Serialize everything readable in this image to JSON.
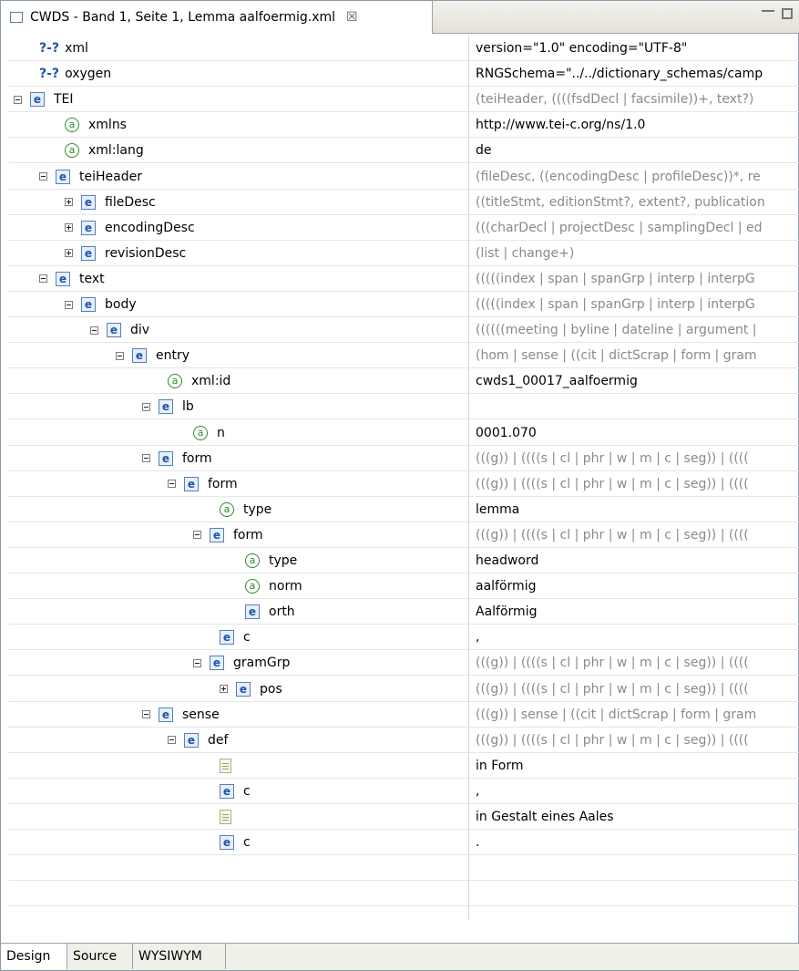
{
  "window": {
    "tab_title": "CWDS - Band 1, Seite 1, Lemma aalfoermig.xml",
    "close_glyph": "☒"
  },
  "bottom_tabs": [
    "Design",
    "Source",
    "WYSIWYM"
  ],
  "rows": [
    {
      "kind": "pi",
      "label": "xml",
      "value": "version=\"1.0\" encoding=\"UTF-8\"",
      "gray": false
    },
    {
      "kind": "pi",
      "label": "oxygen",
      "value": "RNGSchema=\"../../dictionary_schemas/camp",
      "gray": false
    },
    {
      "kind": "element",
      "label": "TEI",
      "value": "(teiHeader, ((((fsdDecl | facsimile))+, text?)",
      "gray": true,
      "toggle": "minus"
    },
    {
      "kind": "attr",
      "label": "xmlns",
      "value": "http://www.tei-c.org/ns/1.0",
      "gray": false
    },
    {
      "kind": "attr",
      "label": "xml:lang",
      "value": "de",
      "gray": false
    },
    {
      "kind": "element",
      "label": "teiHeader",
      "value": "(fileDesc, ((encodingDesc | profileDesc))*, re",
      "gray": true,
      "toggle": "minus"
    },
    {
      "kind": "element",
      "label": "fileDesc",
      "value": "((titleStmt, editionStmt?, extent?, publication",
      "gray": true,
      "toggle": "plus"
    },
    {
      "kind": "element",
      "label": "encodingDesc",
      "value": "(((charDecl | projectDesc | samplingDecl | ed",
      "gray": true,
      "toggle": "plus"
    },
    {
      "kind": "element",
      "label": "revisionDesc",
      "value": "(list | change+)",
      "gray": true,
      "toggle": "plus"
    },
    {
      "kind": "element",
      "label": "text",
      "value": "(((((index | span | spanGrp | interp | interpG",
      "gray": true,
      "toggle": "minus"
    },
    {
      "kind": "element",
      "label": "body",
      "value": "(((((index | span | spanGrp | interp | interpG",
      "gray": true,
      "toggle": "minus"
    },
    {
      "kind": "element",
      "label": "div",
      "value": "((((((meeting | byline | dateline | argument |",
      "gray": true,
      "toggle": "minus"
    },
    {
      "kind": "element",
      "label": "entry",
      "value": "(hom | sense | ((cit | dictScrap | form | gram",
      "gray": true,
      "toggle": "minus"
    },
    {
      "kind": "attr",
      "label": "xml:id",
      "value": "cwds1_00017_aalfoermig",
      "gray": false
    },
    {
      "kind": "element",
      "label": "lb",
      "value": "",
      "gray": false,
      "toggle": "minus"
    },
    {
      "kind": "attr",
      "label": "n",
      "value": "0001.070",
      "gray": false
    },
    {
      "kind": "element",
      "label": "form",
      "value": "(((g)) | ((((s | cl | phr | w | m | c | seg)) | ((((",
      "gray": true,
      "toggle": "minus"
    },
    {
      "kind": "element",
      "label": "form",
      "value": "(((g)) | ((((s | cl | phr | w | m | c | seg)) | ((((",
      "gray": true,
      "toggle": "minus"
    },
    {
      "kind": "attr",
      "label": "type",
      "value": "lemma",
      "gray": false
    },
    {
      "kind": "element",
      "label": "form",
      "value": "(((g)) | ((((s | cl | phr | w | m | c | seg)) | ((((",
      "gray": true,
      "toggle": "minus"
    },
    {
      "kind": "attr",
      "label": "type",
      "value": "headword",
      "gray": false
    },
    {
      "kind": "attr",
      "label": "norm",
      "value": "aalförmig",
      "gray": false
    },
    {
      "kind": "element",
      "label": "orth",
      "value": "Aalförmig",
      "gray": false,
      "toggle": "none"
    },
    {
      "kind": "element",
      "label": "c",
      "value": ",",
      "gray": false,
      "toggle": "none"
    },
    {
      "kind": "element",
      "label": "gramGrp",
      "value": "(((g)) | ((((s | cl | phr | w | m | c | seg)) | ((((",
      "gray": true,
      "toggle": "minus"
    },
    {
      "kind": "element",
      "label": "pos",
      "value": "(((g)) | ((((s | cl | phr | w | m | c | seg)) | ((((",
      "gray": true,
      "toggle": "plus"
    },
    {
      "kind": "element",
      "label": "sense",
      "value": "(((g)) | sense | ((cit | dictScrap | form | gram",
      "gray": true,
      "toggle": "minus"
    },
    {
      "kind": "element",
      "label": "def",
      "value": "(((g)) | ((((s | cl | phr | w | m | c | seg)) | ((((",
      "gray": true,
      "toggle": "minus"
    },
    {
      "kind": "textnode",
      "label": "",
      "value": "in Form",
      "gray": false
    },
    {
      "kind": "element",
      "label": "c",
      "value": ",",
      "gray": false,
      "toggle": "none"
    },
    {
      "kind": "textnode",
      "label": "",
      "value": "in Gestalt eines Aales",
      "gray": false
    },
    {
      "kind": "element",
      "label": "c",
      "value": ".",
      "gray": false,
      "toggle": "none"
    }
  ]
}
